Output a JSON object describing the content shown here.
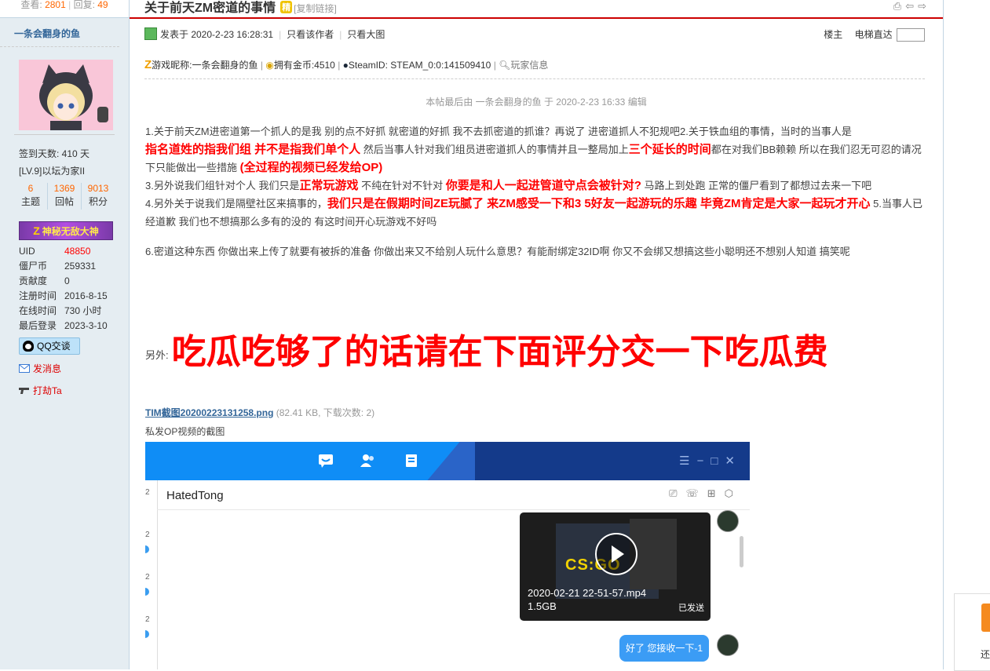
{
  "left": {
    "views_label": "查看:",
    "views": "2801",
    "replies_label": "回复:",
    "replies": "49",
    "author": "一条会翻身的鱼",
    "sign_days": "签到天数: 410 天",
    "level": "[LV.9]以坛为家II",
    "counts": [
      {
        "num": "6",
        "label": "主题"
      },
      {
        "num": "1369",
        "label": "回帖"
      },
      {
        "num": "9013",
        "label": "积分"
      }
    ],
    "medal": "神秘无敌大神",
    "profile": [
      {
        "k": "UID",
        "v": "48850",
        "red": true
      },
      {
        "k": "僵尸币",
        "v": "259331",
        "red": false
      },
      {
        "k": "贡献度",
        "v": "0",
        "red": false
      },
      {
        "k": "注册时间",
        "v": "2016-8-15",
        "red": false
      },
      {
        "k": "在线时间",
        "v": "730 小时",
        "red": false
      },
      {
        "k": "最后登录",
        "v": "2023-3-10",
        "red": false
      }
    ],
    "qq": "QQ交谈",
    "send_msg": "发消息",
    "rob": "打劫Ta"
  },
  "header": {
    "title": "关于前天ZM密道的事情",
    "tag": "精",
    "copy_link": "[复制链接]"
  },
  "meta": {
    "posted": "发表于 2020-2-23 16:28:31",
    "only_author": "只看该作者",
    "big_image": "只看大图",
    "floor": "楼主",
    "elevator": "电梯直达"
  },
  "gameinfo": {
    "nick": "游戏昵称:一条会翻身的鱼",
    "gold": "拥有金币:4510",
    "steam": "SteamID: STEAM_0:0:141509410",
    "player": "玩家信息"
  },
  "edit_note": "本帖最后由 一条会翻身的鱼 于 2020-2-23 16:33 编辑",
  "body": {
    "p1a": "1.关于前天ZM进密道第一个抓人的是我   别的点不好抓 就密道的好抓   我不去抓密道的抓谁？再说了   进密道抓人不犯规吧2.关于铁血组的事情，当时的当事人是",
    "p1b": "指名道姓的指我们组   并不是指我们单个人",
    "p1c": "   然后当事人针对我们组员进密道抓人的事情并且一整局加上",
    "p1d": "三个延长的时间",
    "p1e": "都在对我们BB赖赖   所以在我们忍无可忍的请况下只能做出一些措施 ",
    "p1f": "(全过程的视频已经发给OP)",
    "p3a": "3.另外说我们组针对个人    我们只是",
    "p3b": "正常玩游戏",
    "p3c": " 不纯在针对不针对    ",
    "p3d": "你要是和人一起进管道守点会被针对?",
    "p3e": " 马路上到处跑   正常的僵尸看到了都想过去来一下吧",
    "p4a": "4.另外关于说我们是隔壁社区来搞事的，",
    "p4b": "我们只是在假期时间ZE玩腻了  来ZM感受一下和3 5好友一起游玩的乐趣   毕竟ZM肯定是大家一起玩才开心",
    "p4c": " 5.当事人已经道歉   我们也不想搞那么多有的没的    有这时间开心玩游戏不好吗",
    "p6": "6.密道这种东西   你做出来上传了就要有被拆的准备   你做出来又不给别人玩什么意思？有能耐绑定32ID啊   你又不会绑又想搞这些小聪明还不想别人知道   搞笑呢"
  },
  "extra": {
    "label": "另外:",
    "big": "吃瓜吃够了的话请在下面评分交一下吃瓜费"
  },
  "attachment": {
    "name": "TIM截图20200223131258.png",
    "info": "(82.41 KB, 下载次数: 2)",
    "caption": "私发OP视频的截图"
  },
  "shot": {
    "contact": "HatedTong",
    "video_name": "2020-02-21 22-51-57.mp4",
    "video_size": "1.5GB",
    "sent": "已发送",
    "game_logo": "CS:GO",
    "bubble": "好了 您接收一下-1",
    "strip_chars": [
      "2",
      "2",
      "2",
      "2"
    ]
  },
  "side": {
    "label": "还"
  },
  "colors": {
    "accent_red": "#ff0000",
    "link_blue": "#336699",
    "orange": "#ff6600"
  }
}
